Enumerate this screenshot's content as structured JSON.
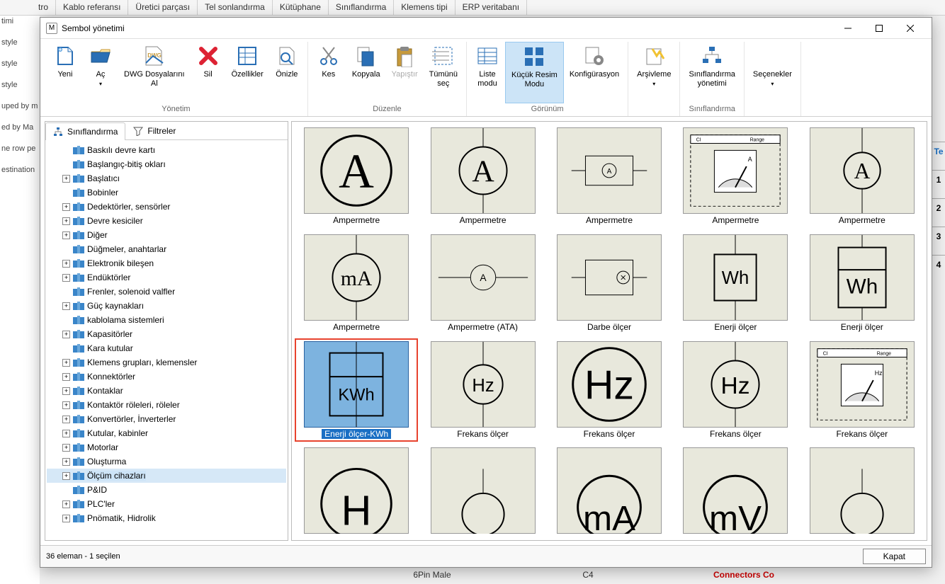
{
  "bg_tabs": [
    "tro",
    "Kablo referansı",
    "Üretici parçası",
    "Tel sonlandırma",
    "Kütüphane",
    "Sınıflandırma",
    "Klemens tipi",
    "ERP veritabanı"
  ],
  "bg_left_frag": "timi",
  "bg_left_lines": [
    "style",
    "style",
    "style",
    "uped by m",
    "",
    "ed by Ma",
    "",
    "ne row pe",
    "estination"
  ],
  "bg_bottom": {
    "col1": "6Pin Male",
    "col2": "C4",
    "col3": "Connectors Co"
  },
  "right_ruler": [
    "Te",
    "1",
    "2",
    "3",
    "4"
  ],
  "dialog": {
    "title": "Sembol yönetimi",
    "status": "36 eleman - 1 seçilen",
    "close_btn": "Kapat"
  },
  "ribbon_groups": [
    {
      "label": "Yönetim",
      "items": [
        {
          "id": "yeni",
          "label": "Yeni",
          "icon": "new"
        },
        {
          "id": "ac",
          "label": "Aç",
          "icon": "open",
          "drop": true
        },
        {
          "id": "dwg",
          "label": "DWG Dosyalarını\nAl",
          "icon": "dwg"
        },
        {
          "id": "sil",
          "label": "Sil",
          "icon": "delete"
        },
        {
          "id": "ozellikler",
          "label": "Özellikler",
          "icon": "props"
        },
        {
          "id": "onizle",
          "label": "Önizle",
          "icon": "preview"
        }
      ]
    },
    {
      "label": "Düzenle",
      "items": [
        {
          "id": "kes",
          "label": "Kes",
          "icon": "cut"
        },
        {
          "id": "kopyala",
          "label": "Kopyala",
          "icon": "copy"
        },
        {
          "id": "yapistir",
          "label": "Yapıştır",
          "icon": "paste",
          "disabled": true
        },
        {
          "id": "tumsec",
          "label": "Tümünü\nseç",
          "icon": "selectall"
        }
      ]
    },
    {
      "label": "Görünüm",
      "items": [
        {
          "id": "liste",
          "label": "Liste\nmodu",
          "icon": "list"
        },
        {
          "id": "thumb",
          "label": "Küçük Resim\nModu",
          "icon": "thumb",
          "active": true
        },
        {
          "id": "konfig",
          "label": "Konfigürasyon",
          "icon": "config"
        }
      ]
    },
    {
      "label": "",
      "items": [
        {
          "id": "arsiv",
          "label": "Arşivleme",
          "icon": "archive",
          "drop": true
        }
      ]
    },
    {
      "label": "Sınıflandırma",
      "items": [
        {
          "id": "sinif",
          "label": "Sınıflandırma\nyönetimi",
          "icon": "class"
        }
      ]
    },
    {
      "label": "",
      "items": [
        {
          "id": "secenek",
          "label": "Seçenekler",
          "icon": "",
          "drop": true
        }
      ]
    }
  ],
  "lp_tabs": [
    {
      "id": "sinif",
      "label": "Sınıflandırma",
      "active": true
    },
    {
      "id": "filtre",
      "label": "Filtreler",
      "active": false
    }
  ],
  "tree": [
    {
      "exp": "",
      "label": "Baskılı devre kartı"
    },
    {
      "exp": "",
      "label": "Başlangıç-bitiş okları"
    },
    {
      "exp": "+",
      "label": "Başlatıcı"
    },
    {
      "exp": "",
      "label": "Bobinler"
    },
    {
      "exp": "+",
      "label": "Dedektörler, sensörler"
    },
    {
      "exp": "+",
      "label": "Devre kesiciler"
    },
    {
      "exp": "+",
      "label": "Diğer"
    },
    {
      "exp": "",
      "label": "Düğmeler, anahtarlar"
    },
    {
      "exp": "+",
      "label": "Elektronik bileşen"
    },
    {
      "exp": "+",
      "label": "Endüktörler"
    },
    {
      "exp": "",
      "label": "Frenler, solenoid valfler"
    },
    {
      "exp": "+",
      "label": "Güç kaynakları"
    },
    {
      "exp": "",
      "label": "kablolama sistemleri"
    },
    {
      "exp": "+",
      "label": "Kapasitörler"
    },
    {
      "exp": "",
      "label": "Kara kutular"
    },
    {
      "exp": "+",
      "label": "Klemens grupları, klemensler"
    },
    {
      "exp": "+",
      "label": "Konnektörler"
    },
    {
      "exp": "+",
      "label": "Kontaklar"
    },
    {
      "exp": "+",
      "label": "Kontaktör röleleri, röleler"
    },
    {
      "exp": "+",
      "label": "Konvertörler, İnverterler"
    },
    {
      "exp": "+",
      "label": "Kutular, kabinler"
    },
    {
      "exp": "+",
      "label": "Motorlar"
    },
    {
      "exp": "+",
      "label": "Oluşturma"
    },
    {
      "exp": "+",
      "label": "Ölçüm cihazları",
      "sel": true
    },
    {
      "exp": "",
      "label": "P&ID"
    },
    {
      "exp": "+",
      "label": "PLC'ler"
    },
    {
      "exp": "+",
      "label": "Pnömatik, Hidrolik"
    }
  ],
  "symbols": [
    {
      "label": "Ampermetre",
      "g": "A_big"
    },
    {
      "label": "Ampermetre",
      "g": "A_circ"
    },
    {
      "label": "Ampermetre",
      "g": "A_box"
    },
    {
      "label": "Ampermetre",
      "g": "A_panel"
    },
    {
      "label": "Ampermetre",
      "g": "A_circ2"
    },
    {
      "label": "Ampermetre",
      "g": "mA"
    },
    {
      "label": "Ampermetre (ATA)",
      "g": "A_small"
    },
    {
      "label": "Darbe ölçer",
      "g": "pulse"
    },
    {
      "label": "Enerji ölçer",
      "g": "Wh_box"
    },
    {
      "label": "Enerji ölçer",
      "g": "Wh_split"
    },
    {
      "label": "Enerji ölçer-KWh",
      "g": "KWh",
      "selected": true
    },
    {
      "label": "Frekans ölçer",
      "g": "Hz_circ"
    },
    {
      "label": "Frekans ölçer",
      "g": "Hz_big"
    },
    {
      "label": "Frekans ölçer",
      "g": "Hz_circ2"
    },
    {
      "label": "Frekans ölçer",
      "g": "Hz_panel"
    },
    {
      "label": "",
      "g": "partial1"
    },
    {
      "label": "",
      "g": "partial2"
    },
    {
      "label": "",
      "g": "partial3"
    },
    {
      "label": "",
      "g": "partial4"
    },
    {
      "label": "",
      "g": "partial5"
    }
  ]
}
